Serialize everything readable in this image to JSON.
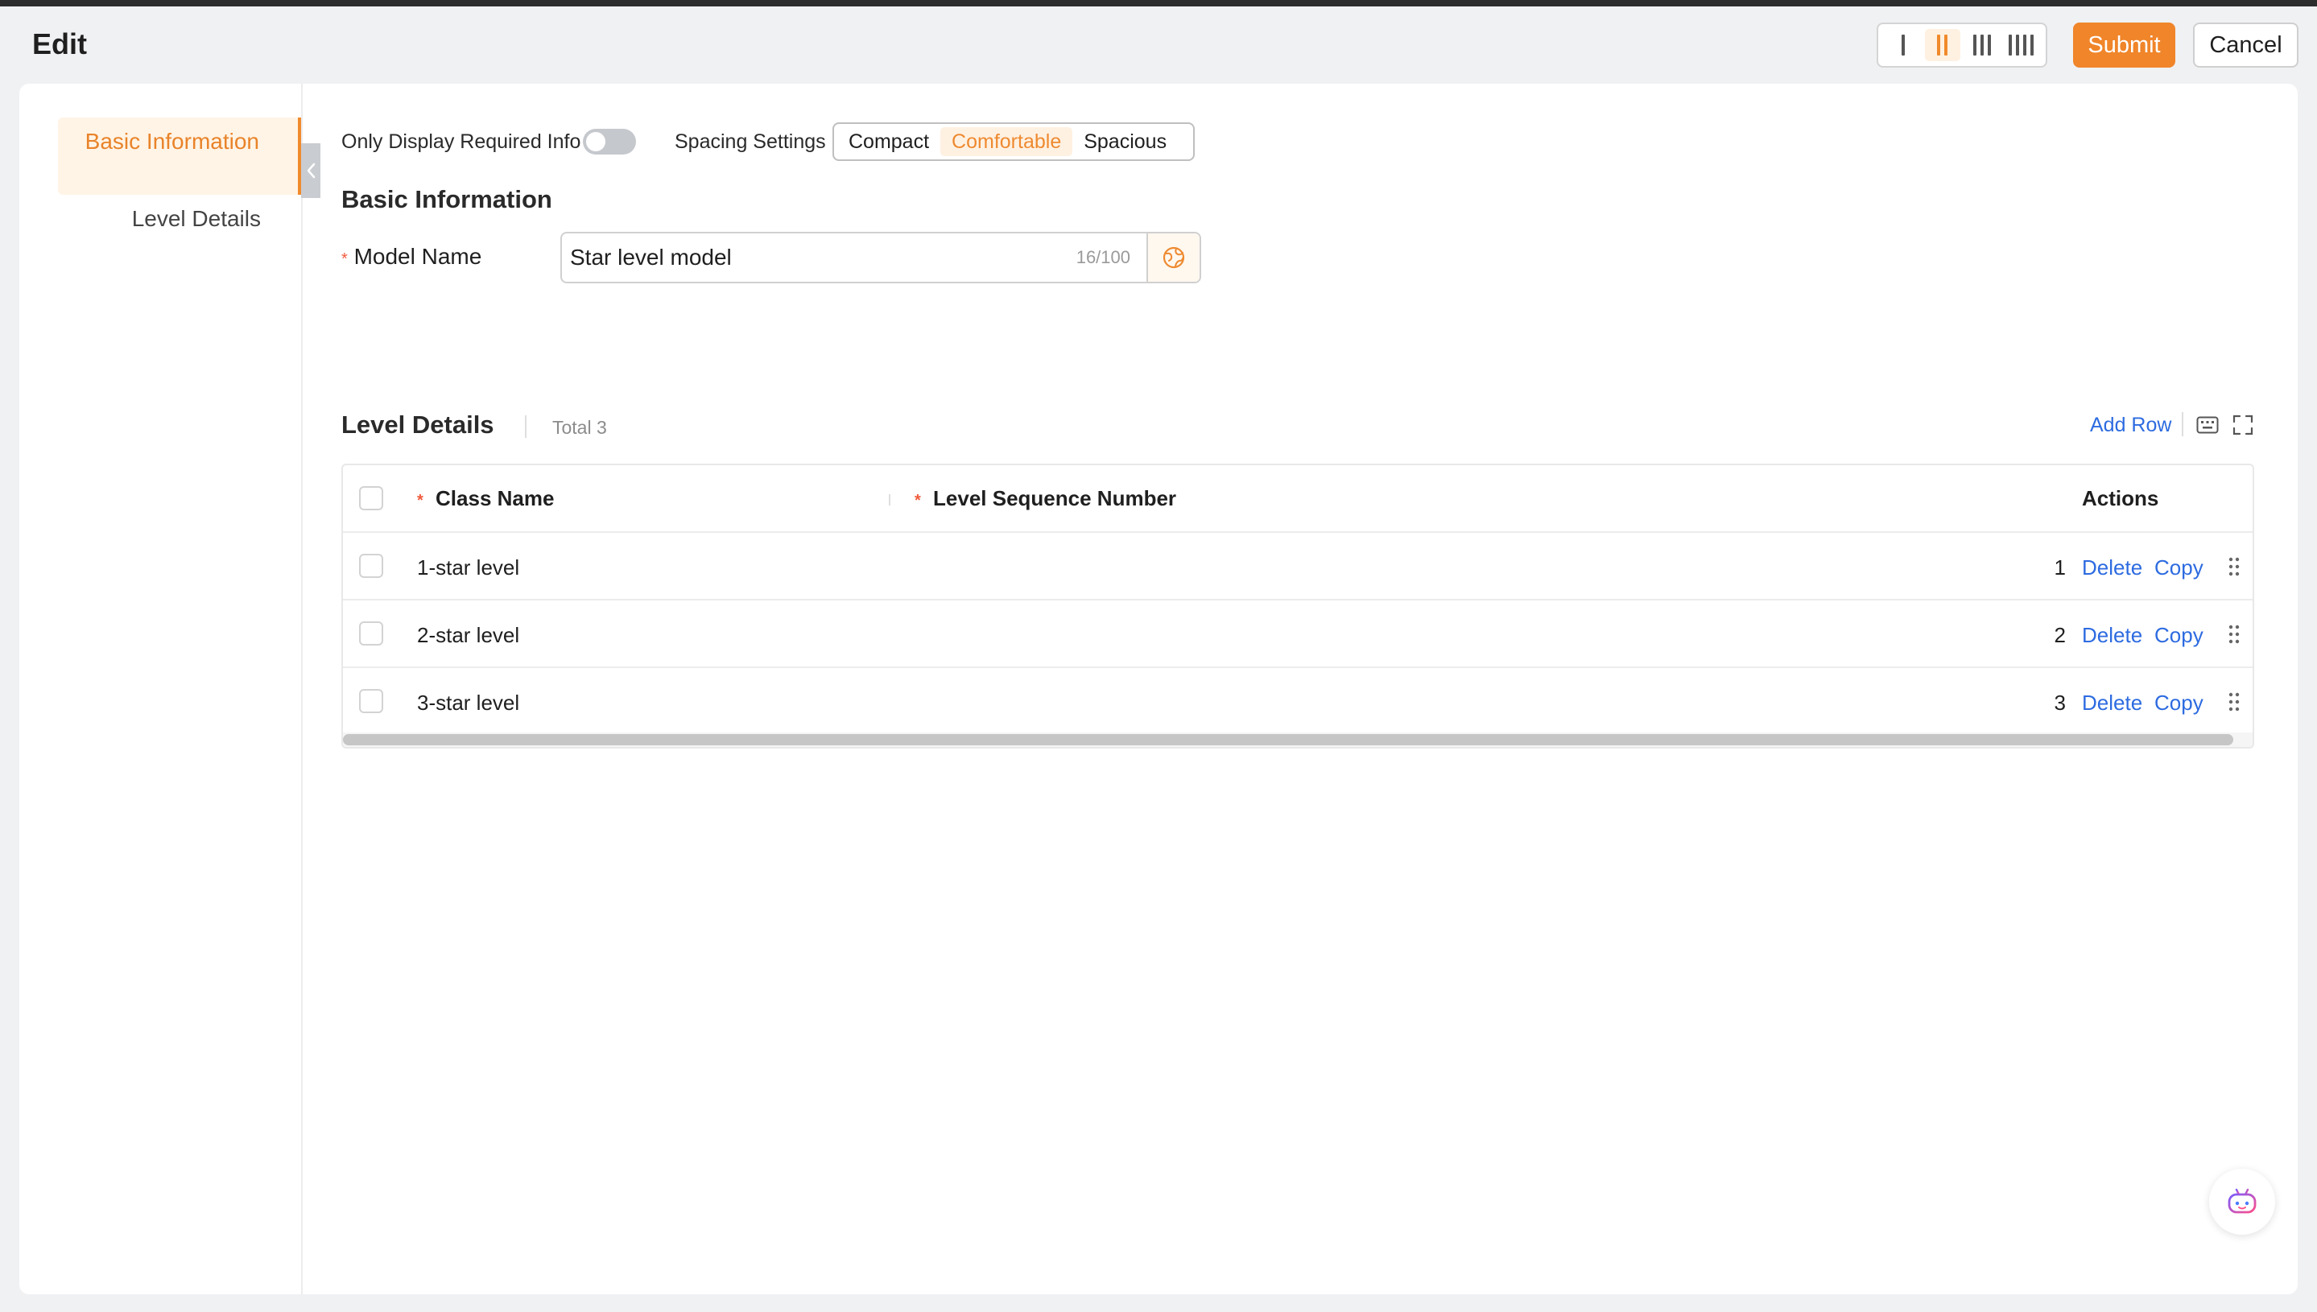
{
  "header": {
    "title": "Edit",
    "column_layout": {
      "options": [
        "1",
        "2",
        "3",
        "4"
      ],
      "selected": "2"
    },
    "submit_label": "Submit",
    "cancel_label": "Cancel"
  },
  "sidebar": {
    "items": [
      {
        "label": "Basic Information",
        "active": true
      },
      {
        "label": "Level Details",
        "active": false
      }
    ]
  },
  "settings": {
    "required_only_label": "Only Display Required Info",
    "required_only_on": false,
    "spacing_label": "Spacing Settings",
    "spacing_options": [
      "Compact",
      "Comfortable",
      "Spacious"
    ],
    "spacing_selected": "Comfortable"
  },
  "basic_info": {
    "title": "Basic Information",
    "model_name_label": "Model Name",
    "model_name_value": "Star level model",
    "model_name_count": "16/100",
    "required_mark": "*"
  },
  "level_details": {
    "title": "Level Details",
    "total_label": "Total 3",
    "add_row_label": "Add Row",
    "columns": {
      "class_name": "Class Name",
      "level_seq": "Level Sequence Number",
      "actions": "Actions"
    },
    "rows": [
      {
        "class_name": "1-star level",
        "seq": "1",
        "delete": "Delete",
        "copy": "Copy"
      },
      {
        "class_name": "2-star level",
        "seq": "2",
        "delete": "Delete",
        "copy": "Copy"
      },
      {
        "class_name": "3-star level",
        "seq": "3",
        "delete": "Delete",
        "copy": "Copy"
      }
    ]
  },
  "colors": {
    "accent": "#f0852a",
    "link": "#2d6be0",
    "required": "#f05a3c"
  }
}
